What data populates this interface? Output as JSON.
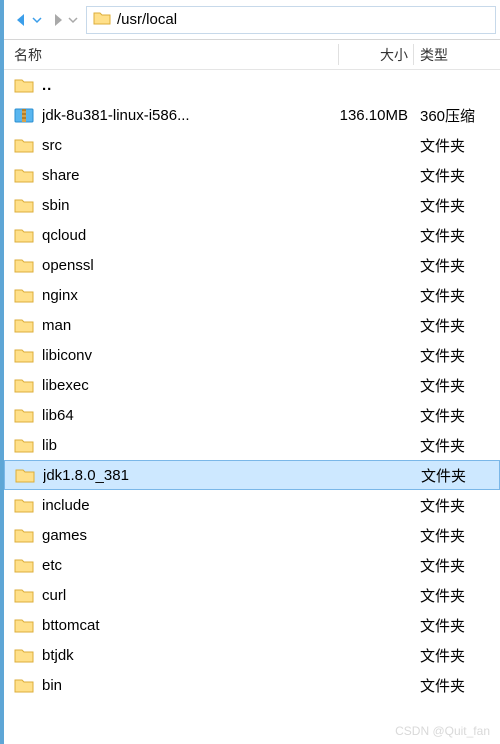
{
  "nav": {
    "path": "/usr/local"
  },
  "columns": {
    "name": "名称",
    "size": "大小",
    "type": "类型"
  },
  "rows": [
    {
      "icon": "folder",
      "name": "..",
      "size": "",
      "type": "",
      "selected": false
    },
    {
      "icon": "archive",
      "name": "jdk-8u381-linux-i586...",
      "size": "136.10MB",
      "type": "360压缩",
      "selected": false
    },
    {
      "icon": "folder",
      "name": "src",
      "size": "",
      "type": "文件夹",
      "selected": false
    },
    {
      "icon": "folder",
      "name": "share",
      "size": "",
      "type": "文件夹",
      "selected": false
    },
    {
      "icon": "folder",
      "name": "sbin",
      "size": "",
      "type": "文件夹",
      "selected": false
    },
    {
      "icon": "folder",
      "name": "qcloud",
      "size": "",
      "type": "文件夹",
      "selected": false
    },
    {
      "icon": "folder",
      "name": "openssl",
      "size": "",
      "type": "文件夹",
      "selected": false
    },
    {
      "icon": "folder",
      "name": "nginx",
      "size": "",
      "type": "文件夹",
      "selected": false
    },
    {
      "icon": "folder",
      "name": "man",
      "size": "",
      "type": "文件夹",
      "selected": false
    },
    {
      "icon": "folder",
      "name": "libiconv",
      "size": "",
      "type": "文件夹",
      "selected": false
    },
    {
      "icon": "folder",
      "name": "libexec",
      "size": "",
      "type": "文件夹",
      "selected": false
    },
    {
      "icon": "folder",
      "name": "lib64",
      "size": "",
      "type": "文件夹",
      "selected": false
    },
    {
      "icon": "folder",
      "name": "lib",
      "size": "",
      "type": "文件夹",
      "selected": false
    },
    {
      "icon": "folder",
      "name": "jdk1.8.0_381",
      "size": "",
      "type": "文件夹",
      "selected": true
    },
    {
      "icon": "folder",
      "name": "include",
      "size": "",
      "type": "文件夹",
      "selected": false
    },
    {
      "icon": "folder",
      "name": "games",
      "size": "",
      "type": "文件夹",
      "selected": false
    },
    {
      "icon": "folder",
      "name": "etc",
      "size": "",
      "type": "文件夹",
      "selected": false
    },
    {
      "icon": "folder",
      "name": "curl",
      "size": "",
      "type": "文件夹",
      "selected": false
    },
    {
      "icon": "folder",
      "name": "bttomcat",
      "size": "",
      "type": "文件夹",
      "selected": false
    },
    {
      "icon": "folder",
      "name": "btjdk",
      "size": "",
      "type": "文件夹",
      "selected": false
    },
    {
      "icon": "folder",
      "name": "bin",
      "size": "",
      "type": "文件夹",
      "selected": false
    }
  ],
  "watermark": "CSDN @Quit_fan"
}
